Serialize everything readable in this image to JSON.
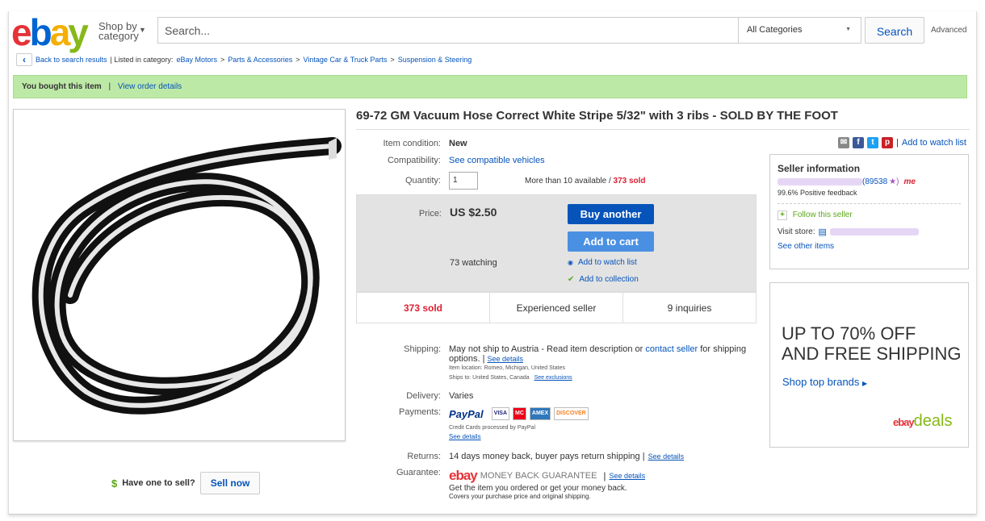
{
  "header": {
    "logo": {
      "e": "e",
      "b": "b",
      "a": "a",
      "y": "y"
    },
    "shop_by": "Shop by",
    "category": "category",
    "search_placeholder": "Search...",
    "category_select": "All Categories",
    "search_button": "Search",
    "advanced": "Advanced"
  },
  "breadcrumb": {
    "back": "Back to search results",
    "listed_in": "| Listed in category:",
    "items": [
      "eBay Motors",
      "Parts & Accessories",
      "Vintage Car & Truck Parts",
      "Suspension & Steering"
    ],
    "sep": ">"
  },
  "banner": {
    "text": "You bought this item",
    "sep": "|",
    "link": "View order details"
  },
  "item": {
    "title": "69-72 GM Vacuum Hose Correct White Stripe 5/32\" with 3 ribs - SOLD BY THE FOOT",
    "condition_label": "Item condition:",
    "condition_value": "New",
    "compat_label": "Compatibility:",
    "compat_link": "See compatible vehicles",
    "quantity_label": "Quantity:",
    "quantity_value": "1",
    "available": "More than 10 available /",
    "sold_count": "373 sold",
    "price_label": "Price:",
    "price": "US $2.50",
    "buy_another": "Buy another",
    "add_to_cart": "Add to cart",
    "watching": "73 watching",
    "add_watch": "Add to watch list",
    "add_collection": "Add to collection"
  },
  "stats": {
    "sold": "373 sold",
    "seller": "Experienced seller",
    "inquiries": "9 inquiries"
  },
  "shipping": {
    "label": "Shipping:",
    "text": "May not ship to Austria - Read item description or",
    "contact": "contact seller",
    "text2": "for shipping",
    "text3": "options. |",
    "see_details": "See details",
    "location": "Item location:  Romeo, Michigan, United States",
    "ships_to": "Ships to:  United States, Canada",
    "see_exclusions": "See exclusions"
  },
  "delivery": {
    "label": "Delivery:",
    "value": "Varies"
  },
  "payments": {
    "label": "Payments:",
    "paypal": "PayPal",
    "cards": [
      "VISA",
      "MC",
      "AMEX",
      "DISCOVER"
    ],
    "note": "Credit Cards processed by PayPal",
    "see_details": "See details"
  },
  "returns": {
    "label": "Returns:",
    "value": "14 days money back, buyer pays return shipping |",
    "see_details": "See details"
  },
  "guarantee": {
    "label": "Guarantee:",
    "logo": "ebay",
    "mbg": "MONEY BACK GUARANTEE",
    "sep": "|",
    "see_details": "See details",
    "line1": "Get the item you ordered or get your money back.",
    "line2": "Covers your purchase price and original shipping."
  },
  "share": {
    "watch": "Add to watch list",
    "sep": "|"
  },
  "seller": {
    "heading": "Seller information",
    "feedback_score": "(89538",
    "feedback_star": "★)",
    "me": "me",
    "positive": "99.6% Positive feedback",
    "follow": "Follow this seller",
    "visit_store": "Visit store:",
    "see_other": "See other items"
  },
  "ad": {
    "line1a": "UP TO ",
    "line1b": "70%",
    "line1c": " OFF",
    "line2": "AND FREE SHIPPING",
    "cta": "Shop top brands",
    "brand": "ebay",
    "deals": "deals"
  },
  "sell": {
    "dollar": "$",
    "text": "Have one to sell?",
    "button": "Sell now"
  },
  "colors": {
    "ebay_red": "#e53238",
    "ebay_blue": "#0064d2",
    "ebay_yellow": "#f5af02",
    "ebay_green": "#86b817",
    "sold_red": "#dd1e31"
  }
}
